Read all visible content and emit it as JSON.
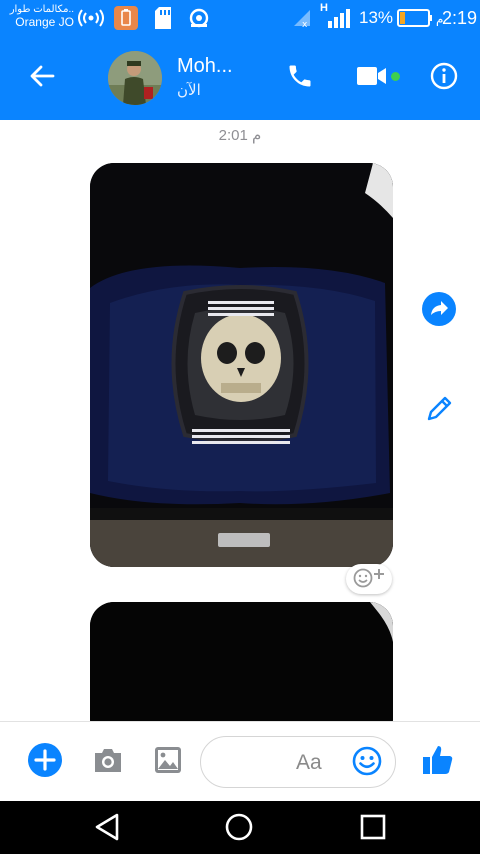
{
  "status_bar": {
    "carrier_line1": "مكالمات طوار..",
    "carrier_line2": "Orange JO",
    "network_type": "H",
    "battery_percent": "13%",
    "time": "2:19",
    "time_suffix": "م",
    "icons": [
      "hotspot-icon",
      "battery-saver-icon",
      "sd-card-icon",
      "sync-icon",
      "signal-x-icon",
      "signal-bars-icon",
      "battery-icon"
    ]
  },
  "header": {
    "contact_name": "Moh...",
    "contact_status": "الآن",
    "icons": [
      "back-arrow-icon",
      "phone-icon",
      "video-camera-icon",
      "info-icon"
    ],
    "accent_color": "#0a84ff",
    "online_color": "#3ed04f"
  },
  "thread": {
    "timestamp": "2:01 م",
    "side_actions": [
      "share-forward-icon",
      "edit-pencil-icon"
    ]
  },
  "composer": {
    "placeholder": "Aa",
    "icons": [
      "plus-icon",
      "camera-icon",
      "gallery-icon",
      "emoji-icon",
      "thumbs-up-icon"
    ]
  },
  "nav_bar": {
    "icons": [
      "back-triangle-icon",
      "home-circle-icon",
      "recents-square-icon"
    ]
  }
}
